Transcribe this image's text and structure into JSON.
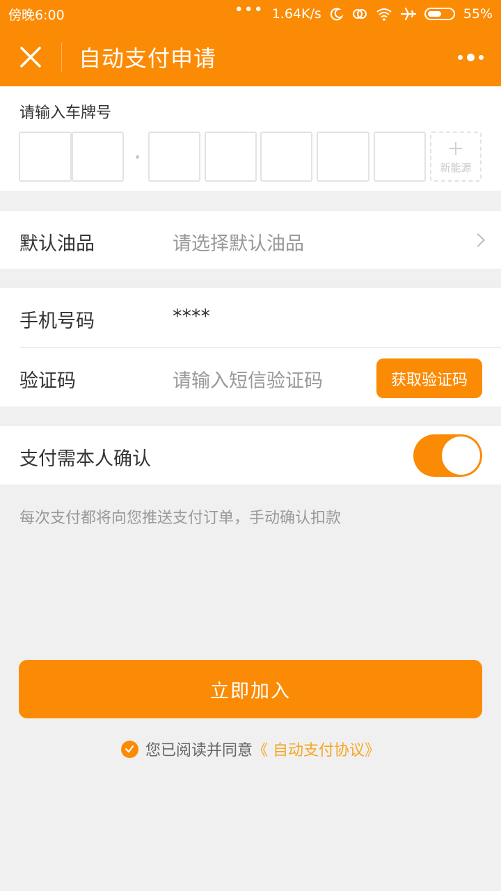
{
  "status_bar": {
    "time": "傍晚6:00",
    "signal_dots": "•••",
    "network_speed": "1.64K/s",
    "battery_percent": "55%",
    "battery_level": 0.55,
    "icons": [
      "moon-icon",
      "sync-icon",
      "wifi-icon",
      "airplane-icon",
      "battery-icon"
    ]
  },
  "header": {
    "title": "自动支付申请",
    "close_icon": "close-icon",
    "more_icon": "more-dots-icon"
  },
  "plate": {
    "label": "请输入车牌号",
    "new_energy_label": "新能源",
    "plus_symbol": "+",
    "slot_count": 7
  },
  "fuel": {
    "label": "默认油品",
    "placeholder": "请选择默认油品"
  },
  "phone": {
    "label": "手机号码",
    "value": "****"
  },
  "sms": {
    "label": "验证码",
    "placeholder": "请输入短信验证码",
    "button_label": "获取验证码"
  },
  "confirm": {
    "label": "支付需本人确认",
    "enabled": true,
    "hint": "每次支付都将向您推送支付订单，手动确认扣款"
  },
  "join_button": "立即加入",
  "agreement": {
    "prefix": "您已阅读并同意",
    "link": "《 自动支付协议》",
    "checked": true
  },
  "colors": {
    "brand": "#fb8b05",
    "link": "#f5a623",
    "background": "#f0f0f0"
  }
}
